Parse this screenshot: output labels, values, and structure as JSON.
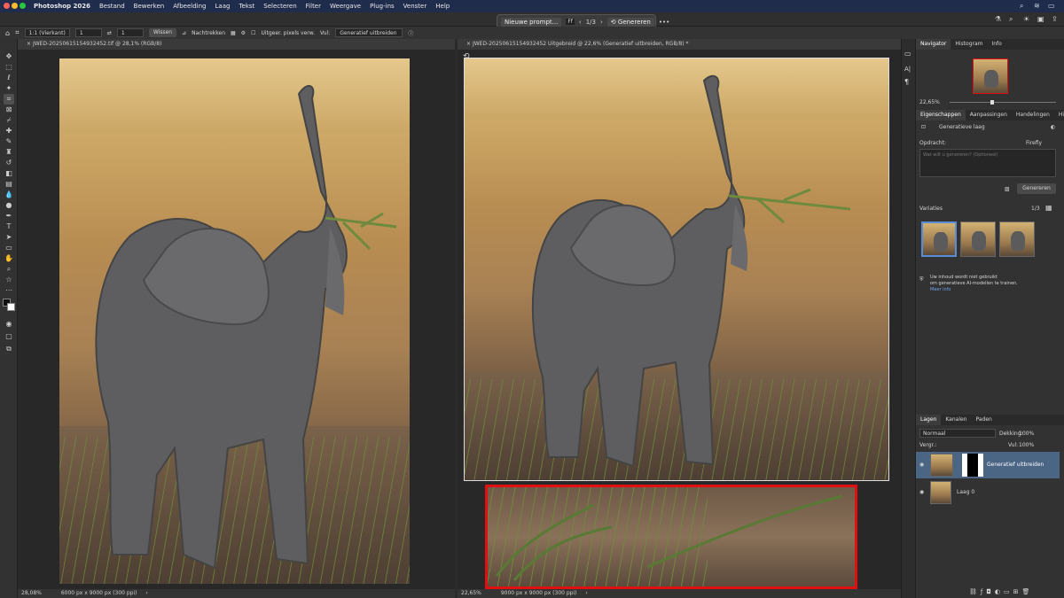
{
  "menubar": {
    "items": [
      "Photoshop 2026",
      "Bestand",
      "Bewerken",
      "Afbeelding",
      "Laag",
      "Tekst",
      "Selecteren",
      "Filter",
      "Weergave",
      "Plug-ins",
      "Venster",
      "Help"
    ]
  },
  "context_bar": {
    "prompt_label": "Nieuwe prompt...",
    "counter": "1/3",
    "generate_label": "Genereren",
    "more": "•••"
  },
  "options": {
    "ratio": "1:1 (Vierkant)",
    "w": "1",
    "h": "1",
    "clear_label": "Wissen",
    "straighten_label": "Nachtrekken",
    "expand_checkbox_label": "Uitgeer. pixels verw.",
    "fill_label": "Vul:",
    "fill_value": "Generatief uitbreiden"
  },
  "doc_left": {
    "tab_title": "JWED-20250615154932452.tif @ 28,1% (RGB/8)",
    "zoom": "28,08%",
    "size": "6000 px x 9000 px (300 ppi)"
  },
  "doc_right": {
    "tab_title": "JWED-20250615154932452 Uitgebreid @ 22,6% (Generatief uitbreiden, RGB/8) *",
    "zoom": "22,65%",
    "size": "9000 px x 9000 px (300 ppi)"
  },
  "navigator": {
    "tabs": [
      "Navigator",
      "Histogram",
      "Info"
    ],
    "zoom": "22,65%"
  },
  "properties": {
    "tabs": [
      "Eigenschappen",
      "Aanpassingen",
      "Handelingen",
      "Historie"
    ],
    "layer_type": "Generatieve laag",
    "model_label": "Opdracht:",
    "model_value": "Firefly",
    "prompt_placeholder": "Wat wilt u genereren? (Optioneel)",
    "generate_label": "Genereren",
    "variations_label": "Variaties",
    "variations_count": "1/3",
    "notice_line1": "Uw inhoud wordt niet gebruikt",
    "notice_line2": "om generatieve AI-modellen te trainen.",
    "notice_link": "Meer info"
  },
  "layers": {
    "tabs": [
      "Lagen",
      "Kanalen",
      "Paden"
    ],
    "blend_mode": "Normaal",
    "opacity_label": "Dekking:",
    "opacity_value": "100%",
    "lock_label": "Vergr.:",
    "fill_label": "Vul:",
    "fill_value": "100%",
    "items": [
      {
        "name": "Generatief uitbreiden",
        "selected": true
      },
      {
        "name": "Laag 0",
        "selected": false
      }
    ]
  },
  "colors": {
    "menubar": "#1f2c4c",
    "highlight_box": "#e01010",
    "layer_selected": "#4b6584"
  }
}
